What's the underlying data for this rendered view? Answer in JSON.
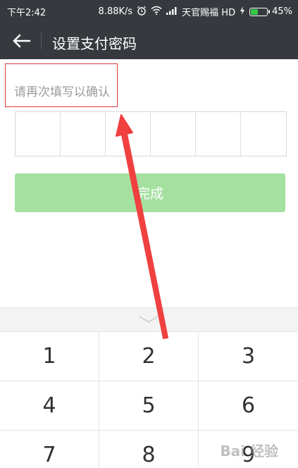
{
  "status_bar": {
    "time": "下午2:42",
    "speed": "8.88K/s",
    "carrier": "天官赐福 HD",
    "battery": "45%",
    "battery_level": 0.45,
    "battery_color": "#35c84a",
    "icons": [
      "alarm-icon",
      "wifi-icon",
      "signal-icon",
      "charging-icon",
      "battery-icon"
    ]
  },
  "titlebar": {
    "title": "设置支付密码",
    "back_icon": "back-arrow-icon"
  },
  "main": {
    "prompt": "请再次填写以确认",
    "pin_digits": 6,
    "done_label": "完成",
    "done_color": "#a5e0a1"
  },
  "keyboard": {
    "collapse_icon": "chevron-down-icon",
    "keys": [
      "1",
      "2",
      "3",
      "4",
      "5",
      "6",
      "7",
      "8",
      "9"
    ]
  },
  "annotation": {
    "box_color": "#d83a3a",
    "arrow_color": "#f04040"
  },
  "watermark": {
    "text": "Bai 经验"
  }
}
